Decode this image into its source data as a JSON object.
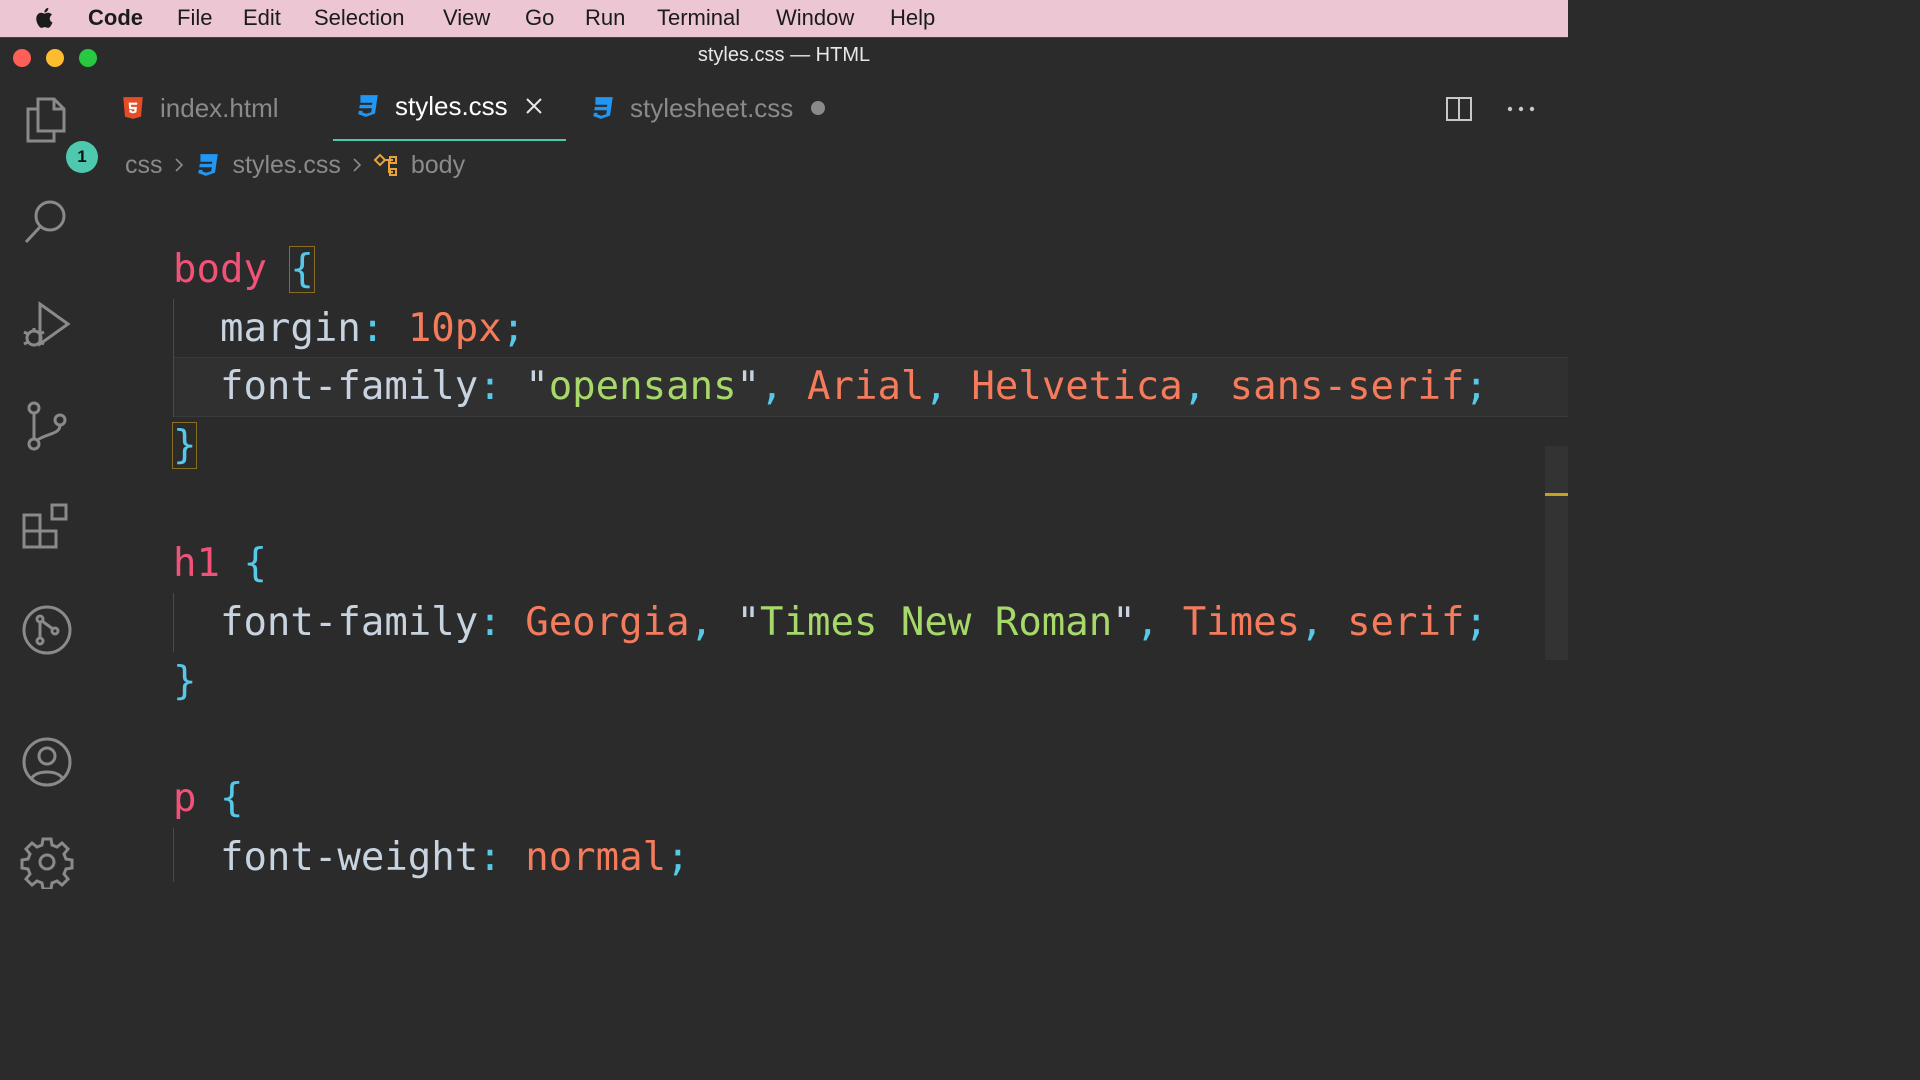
{
  "menubar": {
    "app_name": "Code",
    "items": [
      "File",
      "Edit",
      "Selection",
      "View",
      "Go",
      "Run",
      "Terminal",
      "Window",
      "Help"
    ]
  },
  "window": {
    "title": "styles.css — HTML"
  },
  "activitybar": {
    "explorer_badge": "1",
    "icons": [
      "files-icon",
      "search-icon",
      "run-debug-icon",
      "source-control-icon",
      "extensions-icon",
      "git-graph-icon",
      "account-icon",
      "settings-gear-icon"
    ]
  },
  "tabs": [
    {
      "label": "index.html",
      "icon": "html5-icon",
      "active": false
    },
    {
      "label": "styles.css",
      "icon": "css3-icon",
      "active": true
    },
    {
      "label": "stylesheet.css",
      "icon": "css3-icon",
      "active": false,
      "unsaved": true
    }
  ],
  "breadcrumbs": {
    "folder": "css",
    "file": "styles.css",
    "symbol": "body"
  },
  "code": {
    "rules": [
      {
        "selector": "body",
        "declarations": [
          {
            "property": "margin",
            "value": "10px"
          },
          {
            "property": "font-family",
            "value": "\"opensans\", Arial, Helvetica, sans-serif"
          }
        ]
      },
      {
        "selector": "h1",
        "declarations": [
          {
            "property": "font-family",
            "value": "Georgia, \"Times New Roman\", Times, serif"
          }
        ]
      },
      {
        "selector": "p",
        "declarations": [
          {
            "property": "font-weight",
            "value": "normal"
          }
        ]
      }
    ],
    "tokens": {
      "l1_sel": "body",
      "l1_brace": "{",
      "l2_prop": "margin",
      "l2_colon": ":",
      "l2_val": "10px",
      "l2_semi": ";",
      "l3_prop": "font-family",
      "l3_colon": ":",
      "l3_q1": "\"",
      "l3_str": "opensans",
      "l3_q2": "\"",
      "l3_c1": ",",
      "l3_v2": "Arial",
      "l3_c2": ",",
      "l3_v3": "Helvetica",
      "l3_c3": ",",
      "l3_v4": "sans-serif",
      "l3_semi": ";",
      "l4_brace": "}",
      "l6_sel": "h1",
      "l6_brace": "{",
      "l7_prop": "font-family",
      "l7_colon": ":",
      "l7_v1": "Georgia",
      "l7_c1": ",",
      "l7_q1": "\"",
      "l7_str": "Times New Roman",
      "l7_q2": "\"",
      "l7_c2": ",",
      "l7_v3": "Times",
      "l7_c3": ",",
      "l7_v4": "serif",
      "l7_semi": ";",
      "l8_brace": "}",
      "l10_sel": "p",
      "l10_brace": "{",
      "l11_prop": "font-weight",
      "l11_colon": ":",
      "l11_val": "normal",
      "l11_semi": ";"
    }
  },
  "colors": {
    "selector": "#f25278",
    "brace": "#56c8e8",
    "string": "#a6d96a",
    "value": "#f47b5b",
    "active_tab_underline": "#4ec9b0",
    "menubar_bg": "#ecc7d3"
  }
}
